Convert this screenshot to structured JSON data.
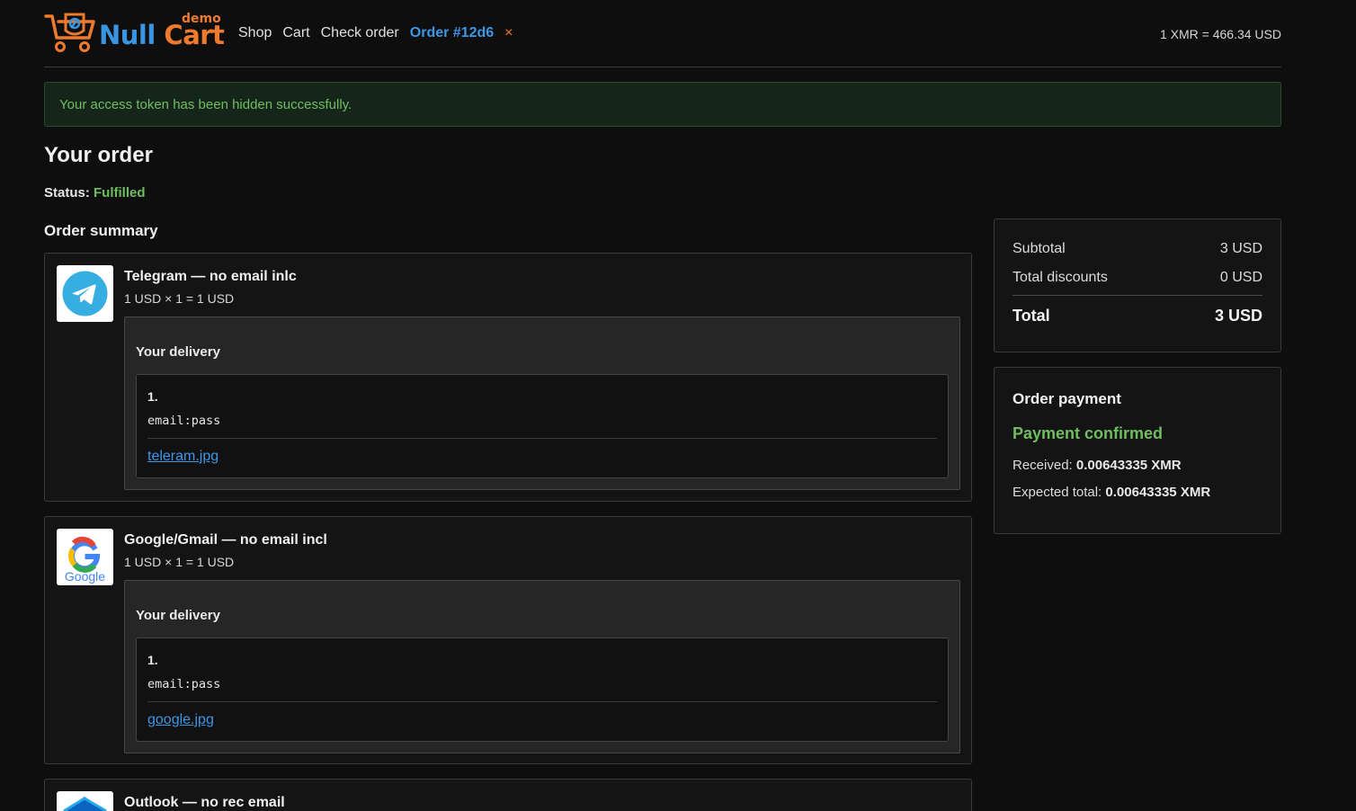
{
  "header": {
    "logo": {
      "word1": "Null",
      "word2": "Cart",
      "badge": "demo"
    },
    "nav": [
      {
        "label": "Shop"
      },
      {
        "label": "Cart"
      },
      {
        "label": "Check order"
      }
    ],
    "order_tab": {
      "label": "Order #12d6",
      "close": "×"
    },
    "rate": "1 XMR = 466.34 USD"
  },
  "alert": {
    "text": "Your access token has been hidden successfully."
  },
  "page": {
    "title": "Your order",
    "status_label": "Status:",
    "status_value": "Fulfilled",
    "summary_title": "Order summary"
  },
  "items": [
    {
      "name": "Telegram — no email inlc",
      "price": "1 USD × 1 = 1 USD",
      "icon": "telegram-icon",
      "delivery_title": "Your delivery",
      "entry_number": "1.",
      "entry_credentials": "email:pass",
      "entry_file": "teleram.jpg"
    },
    {
      "name": "Google/Gmail — no email incl",
      "price": "1 USD × 1 = 1 USD",
      "icon": "google-icon",
      "delivery_title": "Your delivery",
      "entry_number": "1.",
      "entry_credentials": "email:pass",
      "entry_file": "google.jpg"
    },
    {
      "name": "Outlook — no rec email",
      "icon": "outlook-icon"
    }
  ],
  "totals": {
    "subtotal_label": "Subtotal",
    "subtotal_value": "3 USD",
    "discounts_label": "Total discounts",
    "discounts_value": "0 USD",
    "total_label": "Total",
    "total_value": "3 USD"
  },
  "payment": {
    "title": "Order payment",
    "status": "Payment confirmed",
    "received_label": "Received:",
    "received_value": "0.00643335 XMR",
    "expected_label": "Expected total:",
    "expected_value": "0.00643335 XMR"
  },
  "colors": {
    "background": "#0e0e0e",
    "accent_blue": "#3d96e6",
    "accent_orange": "#ee7a2e",
    "success_green": "#6fbd61"
  }
}
